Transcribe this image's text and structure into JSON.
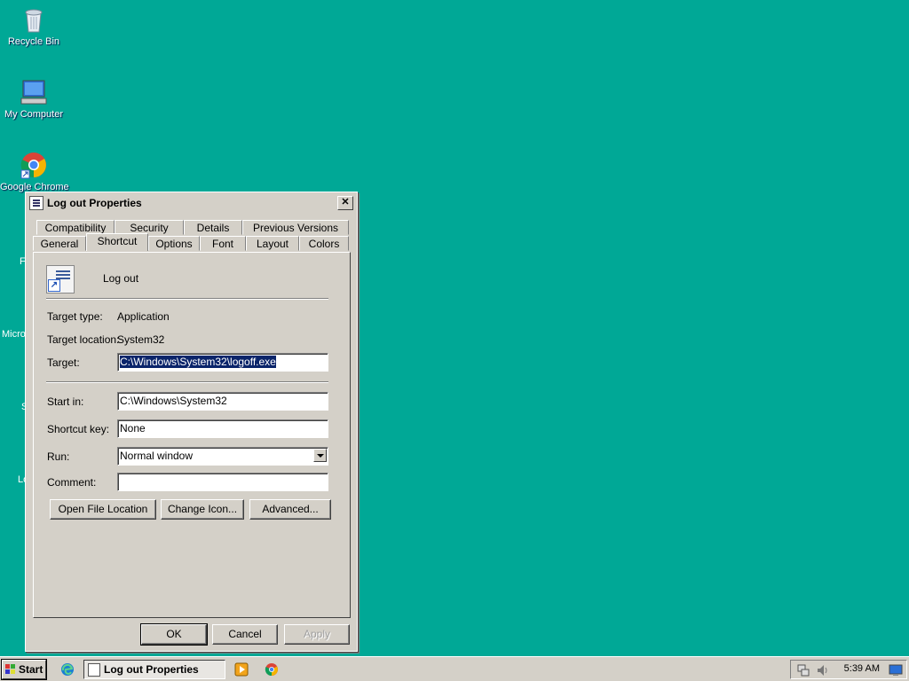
{
  "desktop": {
    "icons": [
      {
        "label": "Recycle Bin",
        "icon": "recycle-bin-icon"
      },
      {
        "label": "My Computer",
        "icon": "my-computer-icon"
      },
      {
        "label": "Google Chrome",
        "icon": "chrome-icon"
      }
    ],
    "partial_labels": [
      "F",
      "Micro",
      "S",
      "Lo"
    ]
  },
  "dialog": {
    "title": "Log out Properties",
    "tabs_row1": [
      "Compatibility",
      "Security",
      "Details",
      "Previous Versions"
    ],
    "tabs_row2": [
      "General",
      "Shortcut",
      "Options",
      "Font",
      "Layout",
      "Colors"
    ],
    "active_tab": "Shortcut",
    "shortcut_name": "Log out",
    "target_type_label": "Target type:",
    "target_type_value": "Application",
    "target_location_label": "Target location:",
    "target_location_value": "System32",
    "target_label": "Target:",
    "target_value": "C:\\Windows\\System32\\logoff.exe",
    "start_in_label": "Start in:",
    "start_in_value": "C:\\Windows\\System32",
    "shortcut_key_label": "Shortcut key:",
    "shortcut_key_value": "None",
    "run_label": "Run:",
    "run_value": "Normal window",
    "comment_label": "Comment:",
    "comment_value": "",
    "buttons": {
      "open_file_location": "Open File Location",
      "change_icon": "Change Icon...",
      "advanced": "Advanced...",
      "ok": "OK",
      "cancel": "Cancel",
      "apply": "Apply"
    }
  },
  "taskbar": {
    "start_label": "Start",
    "task_label": "Log out Properties",
    "clock": "5:39 AM"
  }
}
